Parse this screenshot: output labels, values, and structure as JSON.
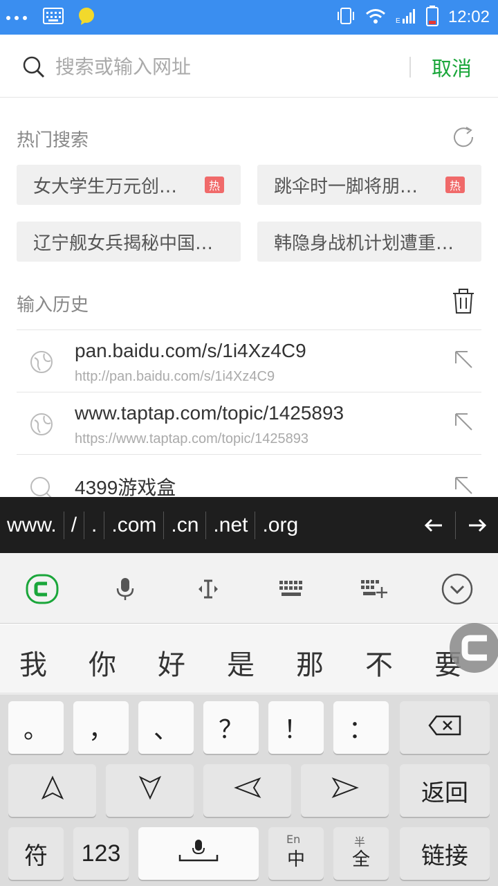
{
  "status_bar": {
    "time": "12:02",
    "icons": [
      "more-dots-icon",
      "keyboard-icon",
      "chat-bubble-icon",
      "vibrate-icon",
      "wifi-icon",
      "signal-icon",
      "battery-icon"
    ],
    "color": "#3a8ef0"
  },
  "search": {
    "placeholder": "搜索或输入网址",
    "cancel_label": "取消",
    "accent": "#1aa63a"
  },
  "hot": {
    "title": "热门搜索",
    "badge": "热",
    "items": [
      {
        "text": "女大学生万元创…",
        "hot": true
      },
      {
        "text": "跳伞时一脚将朋…",
        "hot": true
      },
      {
        "text": "辽宁舰女兵揭秘中国…",
        "hot": false
      },
      {
        "text": "韩隐身战机计划遭重…",
        "hot": false
      }
    ]
  },
  "history": {
    "title": "输入历史",
    "items": [
      {
        "title": "pan.baidu.com/s/1i4Xz4C9",
        "url": "http://pan.baidu.com/s/1i4Xz4C9",
        "icon": "globe-icon"
      },
      {
        "title": "www.taptap.com/topic/1425893",
        "url": "https://www.taptap.com/topic/1425893",
        "icon": "globe-icon"
      },
      {
        "title": "4399游戏盒",
        "url": "",
        "icon": "search-icon"
      }
    ]
  },
  "shortcuts": {
    "keys": [
      "www.",
      "/",
      ".",
      ".com",
      ".cn",
      ".net",
      ".org"
    ]
  },
  "candidates": [
    "我",
    "你",
    "好",
    "是",
    "那",
    "不",
    "要"
  ],
  "keyboard": {
    "row1": [
      "。",
      "，",
      "、",
      "？",
      "！",
      "："
    ],
    "row2_right": "返回",
    "row3": {
      "symbol": "符",
      "numeric": "123",
      "lang_top": "En",
      "lang_main": "中",
      "width_top": "半",
      "width_main": "全",
      "enter": "链接"
    }
  }
}
